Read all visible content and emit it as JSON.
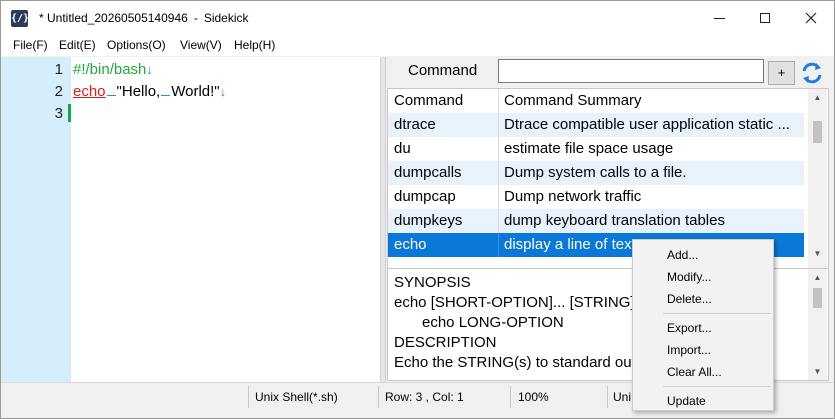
{
  "window": {
    "icon_text": "{/}",
    "title_modified": "* Untitled_20260505140946",
    "title_sep": "-",
    "title_app": "Sidekick"
  },
  "menu": [
    "File(F)",
    "Edit(E)",
    "Options(O)",
    "View(V)",
    "Help(H)"
  ],
  "editor": {
    "line_numbers": [
      "1",
      "2",
      "3"
    ],
    "line1": "#!/bin/bash",
    "line2_cmd": "echo",
    "line2_word1": "\"Hello,",
    "line2_word2": "World!\"",
    "eol_mark": "↓"
  },
  "command_panel": {
    "label": "Command",
    "input_value": "",
    "add_label": "+",
    "refresh_icon": "refresh-icon"
  },
  "table": {
    "headers": {
      "name": "Command",
      "summary": "Command Summary"
    },
    "rows": [
      {
        "name": "dtrace",
        "summary": "Dtrace compatible user application static ..."
      },
      {
        "name": "du",
        "summary": "estimate file space usage"
      },
      {
        "name": "dumpcalls",
        "summary": "Dump system calls to a file."
      },
      {
        "name": "dumpcap",
        "summary": "Dump network traffic"
      },
      {
        "name": "dumpkeys",
        "summary": "dump keyboard translation tables"
      },
      {
        "name": "echo",
        "summary": "display a line of text"
      }
    ],
    "selected_index": 5
  },
  "description": {
    "lines": [
      "SYNOPSIS",
      "echo [SHORT-OPTION]... [STRING]...",
      "echo LONG-OPTION",
      "DESCRIPTION",
      "Echo the STRING(s) to standard output."
    ]
  },
  "status": {
    "language": "Unix Shell(*.sh)",
    "position": "Row: 3 ,  Col: 1",
    "zoom": "100%",
    "encoding_partial": "Uni"
  },
  "context_menu": {
    "items": [
      "Add...",
      "Modify...",
      "Delete...",
      "Export...",
      "Import...",
      "Clear All...",
      "Update"
    ]
  },
  "colors": {
    "gutter": "#d4eefb",
    "selection": "#0a78d6",
    "alt_row": "#e8f2fc",
    "comment_green": "#22a83a",
    "keyword_red": "#d42020"
  }
}
